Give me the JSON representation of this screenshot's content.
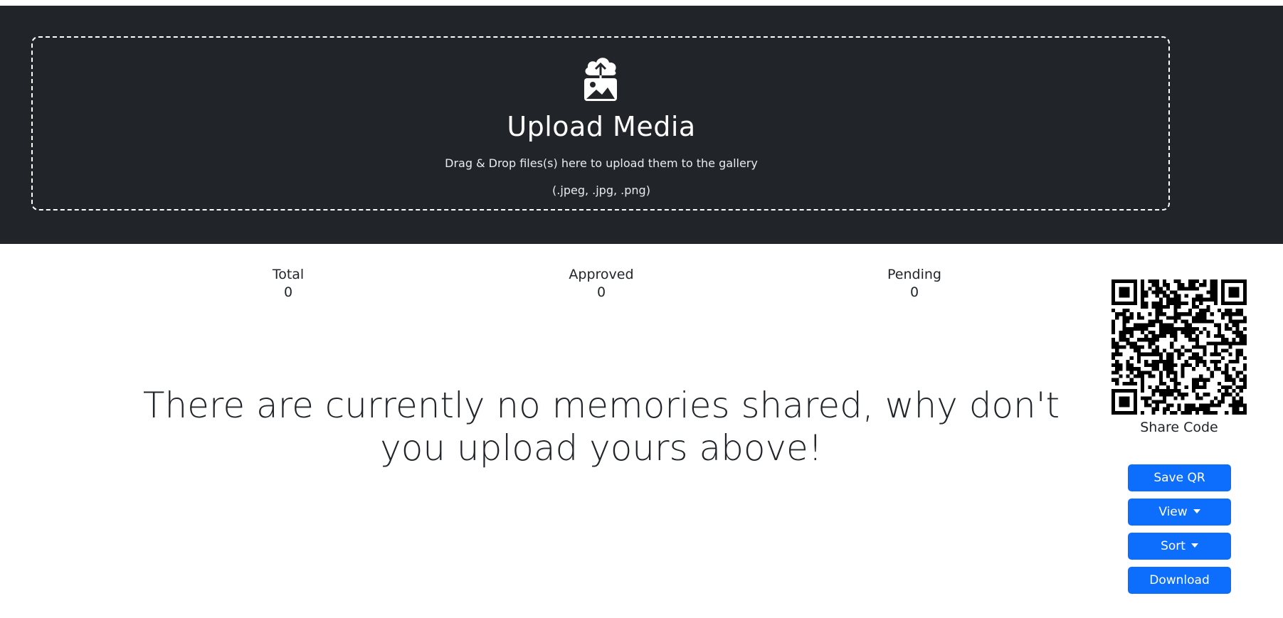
{
  "upload": {
    "title": "Upload Media",
    "instructions": "Drag & Drop files(s) here to upload them to the gallery",
    "accepted_types": "(.jpeg, .jpg, .png)",
    "icon": "cloud-upload-image-icon"
  },
  "stats": {
    "total_label": "Total",
    "total_value": "0",
    "approved_label": "Approved",
    "approved_value": "0",
    "pending_label": "Pending",
    "pending_value": "0"
  },
  "main": {
    "empty_message": "There are currently no memories shared, why don't you upload yours above!"
  },
  "share": {
    "label": "Share Code",
    "qr_icon": "qr-code-icon"
  },
  "actions": {
    "save_qr": "Save QR",
    "view": "View",
    "sort": "Sort",
    "download": "Download"
  },
  "colors": {
    "hero_bg": "#212529",
    "primary": "#0d6efd",
    "text": "#212529"
  }
}
